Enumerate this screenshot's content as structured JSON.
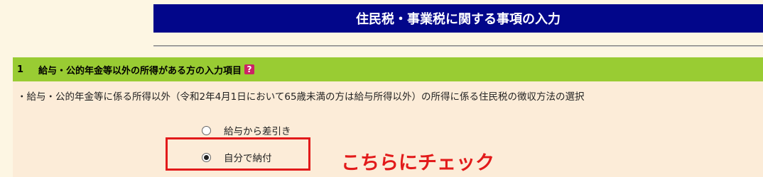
{
  "page": {
    "title": "住民税・事業税に関する事項の入力"
  },
  "section": {
    "number": "1",
    "heading": "給与・公的年金等以外の所得がある方の入力項目",
    "help_icon_label": "?",
    "description": "・給与・公的年金等に係る所得以外（令和2年4月1日において65歳未満の方は給与所得以外）の所得に係る住民税の徴収方法の選択"
  },
  "options": [
    {
      "label": "給与から差引き",
      "selected": false
    },
    {
      "label": "自分で納付",
      "selected": true
    }
  ],
  "annotation": {
    "text": "こちらにチェック",
    "color": "#e21a1a"
  },
  "colors": {
    "title_bar": "#02068a",
    "section_header": "#99cc33",
    "content_bg": "#fcecd8",
    "page_bg": "#fdf6e3"
  }
}
